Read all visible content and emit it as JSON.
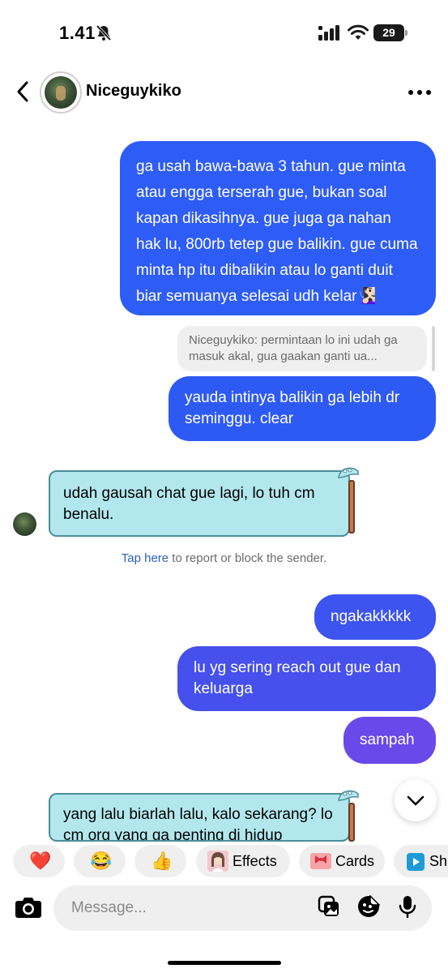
{
  "status_bar": {
    "time": "1.41",
    "battery": "29",
    "icons": [
      "bell-slash-icon",
      "cellular-signal-icon",
      "wifi-icon",
      "battery-icon"
    ]
  },
  "header": {
    "contact_name": "Niceguykiko",
    "icons": [
      "back-chevron-icon",
      "more-options-icon"
    ]
  },
  "messages": [
    {
      "direction": "outgoing",
      "text": "ga usah bawa-bawa 3 tahun. gue minta atau engga terserah gue, bukan soal kapan dikasihnya. gue juga ga nahan hak lu, 800rb tetep gue balikin. gue cuma minta hp itu dibalikin atau lo ganti duit biar semuanya selesai udh kelar🧏🏻‍♀️"
    },
    {
      "direction": "outgoing",
      "reply_to": "Niceguykiko: permintaan lo ini udah ga masuk akal, gua gaakan ganti ua...",
      "text": "yauda intinya balikin ga lebih dr seminggu. clear"
    },
    {
      "direction": "incoming",
      "text": "udah gausah chat gue lagi, lo tuh cm benalu."
    },
    {
      "direction": "outgoing",
      "text": "ngakakkkkk"
    },
    {
      "direction": "outgoing",
      "text": "lu yg sering reach out gue dan keluarga"
    },
    {
      "direction": "outgoing",
      "text": "sampah"
    },
    {
      "direction": "incoming",
      "text": "yang lalu biarlah lalu, kalo sekarang? lo cm org yang ga penting di hidup"
    }
  ],
  "report": {
    "link": "Tap here",
    "rest": " to report or block the sender."
  },
  "quick_bar": {
    "reactions": [
      "❤️",
      "😂",
      "👍"
    ],
    "effects_label": "Effects",
    "cards_label": "Cards",
    "sh_label": "Sh"
  },
  "composer": {
    "placeholder": "Message...",
    "icons": [
      "camera-icon",
      "gallery-icon",
      "sticker-icon",
      "microphone-icon"
    ]
  },
  "colors": {
    "bubble_1": "#2e5cf6",
    "bubble_2": "#2e5af4",
    "bubble_3": "#3d54f0",
    "bubble_4": "#4650ec",
    "bubble_5": "#6a49ea",
    "incoming_bubble": "#b3e7ee",
    "link": "#2d5fc4"
  }
}
